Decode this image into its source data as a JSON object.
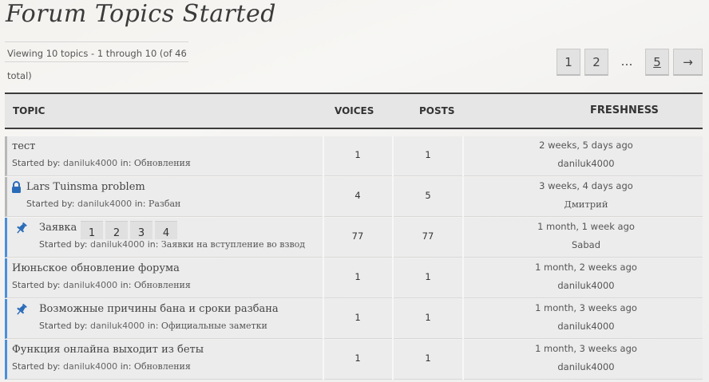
{
  "page": {
    "title": "Forum Topics Started"
  },
  "viewing": "Viewing 10 topics - 1 through 10 (of 46 total)",
  "pagination": {
    "pages": [
      "1",
      "2",
      "…",
      "5"
    ],
    "next": "→"
  },
  "columns": {
    "topic": "TOPIC",
    "voices": "VOICES",
    "posts": "POSTS",
    "freshness": "FRESHNESS"
  },
  "labels": {
    "started_by": "Started by:",
    "in": "in:"
  },
  "topics": [
    {
      "title": "тест",
      "author": "daniluk4000",
      "forum": "Обновления",
      "voices": "1",
      "posts": "1",
      "fresh_time": "2 weeks, 5 days ago",
      "fresh_user": "daniluk4000",
      "icon": "",
      "pages": []
    },
    {
      "title": "Lars Tuinsma problem",
      "author": "daniluk4000",
      "forum": "Разбан",
      "voices": "4",
      "posts": "5",
      "fresh_time": "3 weeks, 4 days ago",
      "fresh_user": "Дмитрий",
      "icon": "lock-icon",
      "pages": []
    },
    {
      "title": "Заявка",
      "author": "daniluk4000",
      "forum": "Заявки на вступление во взвод",
      "voices": "77",
      "posts": "77",
      "fresh_time": "1 month, 1 week ago",
      "fresh_user": "Sabad",
      "icon": "pin-icon",
      "pages": [
        "1",
        "2",
        "3",
        "4"
      ]
    },
    {
      "title": "Июньское обновление форума",
      "author": "daniluk4000",
      "forum": "Обновления",
      "voices": "1",
      "posts": "1",
      "fresh_time": "1 month, 2 weeks ago",
      "fresh_user": "daniluk4000",
      "icon": "",
      "pages": []
    },
    {
      "title": "Возможные причины бана и сроки разбана",
      "author": "daniluk4000",
      "forum": "Официальные заметки",
      "voices": "1",
      "posts": "1",
      "fresh_time": "1 month, 3 weeks ago",
      "fresh_user": "daniluk4000",
      "icon": "pin-icon",
      "pages": []
    },
    {
      "title": "Функция онлайна выходит из беты",
      "author": "daniluk4000",
      "forum": "Обновления",
      "voices": "1",
      "posts": "1",
      "fresh_time": "1 month, 3 weeks ago",
      "fresh_user": "daniluk4000",
      "icon": "",
      "pages": []
    }
  ],
  "colors": {
    "accent": "#4a90d9",
    "header_border": "#3c3c3c",
    "row_bg": "#ececec"
  }
}
